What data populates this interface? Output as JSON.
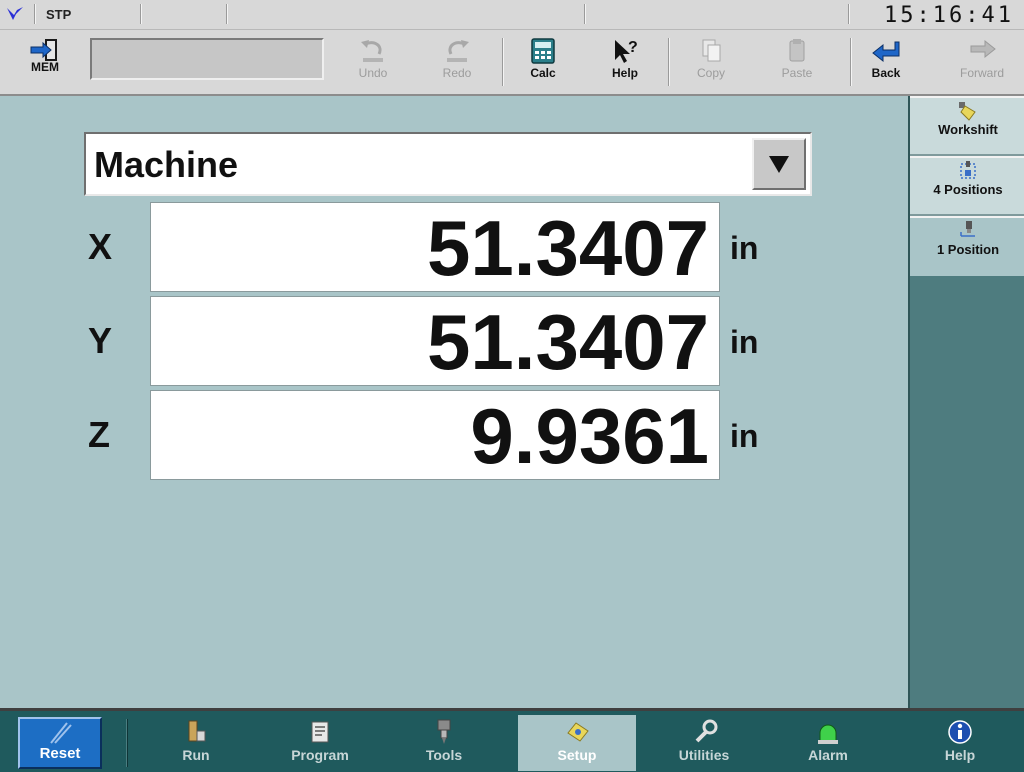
{
  "status": {
    "mode": "STP",
    "clock": "15:16:41"
  },
  "toolbar": {
    "mem_label": "MEM",
    "mem_value": "",
    "buttons": [
      {
        "label": "Undo",
        "icon": "undo-icon",
        "enabled": false
      },
      {
        "label": "Redo",
        "icon": "redo-icon",
        "enabled": false
      },
      {
        "label": "Calc",
        "icon": "calculator-icon",
        "enabled": true
      },
      {
        "label": "Help",
        "icon": "help-pointer-icon",
        "enabled": true
      },
      {
        "label": "Copy",
        "icon": "copy-icon",
        "enabled": false
      },
      {
        "label": "Paste",
        "icon": "paste-icon",
        "enabled": false
      },
      {
        "label": "Back",
        "icon": "back-arrow-icon",
        "enabled": true
      },
      {
        "label": "Forward",
        "icon": "forward-arrow-icon",
        "enabled": false
      }
    ]
  },
  "coordinate_system": {
    "selected": "Machine"
  },
  "axes": [
    {
      "axis": "X",
      "value": "51.3407",
      "unit": "in"
    },
    {
      "axis": "Y",
      "value": "51.3407",
      "unit": "in"
    },
    {
      "axis": "Z",
      "value": "9.9361",
      "unit": "in"
    }
  ],
  "side_tabs": [
    {
      "label": "Workshift",
      "icon": "workshift-icon",
      "active": false
    },
    {
      "label": "4 Positions",
      "icon": "four-positions-icon",
      "active": false
    },
    {
      "label": "1 Position",
      "icon": "one-position-icon",
      "active": true
    }
  ],
  "bottom_nav": {
    "reset": "Reset",
    "items": [
      {
        "label": "Run",
        "icon": "run-icon",
        "active": false
      },
      {
        "label": "Program",
        "icon": "program-icon",
        "active": false
      },
      {
        "label": "Tools",
        "icon": "tools-icon",
        "active": false
      },
      {
        "label": "Setup",
        "icon": "setup-icon",
        "active": true
      },
      {
        "label": "Utilities",
        "icon": "wrench-icon",
        "active": false
      },
      {
        "label": "Alarm",
        "icon": "alarm-light-icon",
        "active": false
      },
      {
        "label": "Help",
        "icon": "info-icon",
        "active": false
      }
    ]
  },
  "colors": {
    "main_bg": "#a9c5c8",
    "side_bg": "#4e7c7f",
    "nav_bg": "#1f5a5d",
    "reset_bg": "#1d6ec4"
  }
}
